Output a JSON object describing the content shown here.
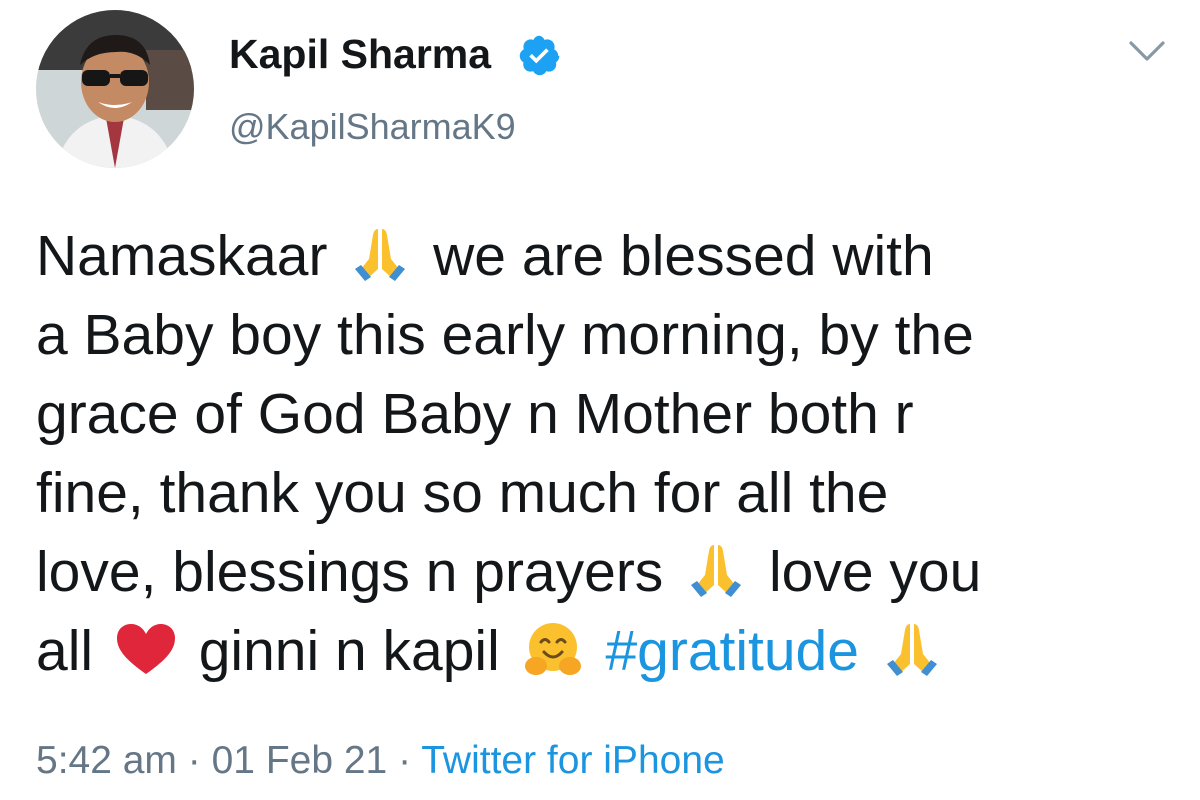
{
  "author": {
    "display_name": "Kapil Sharma",
    "handle": "@KapilSharmaK9",
    "verified": true,
    "avatar_icon": "profile-photo",
    "verified_icon": "verified-badge-icon"
  },
  "menu_icon": "chevron-down-icon",
  "tweet": {
    "lines": {
      "l1a": "Namaskaar",
      "l1b": "we are blessed with",
      "l2": "a Baby boy this early morning, by the",
      "l3": "grace of God Baby n Mother both r",
      "l4": "fine, thank you so much for all the",
      "l5a": "love, blessings n prayers",
      "l5b": "love you",
      "l6a": "all",
      "l6b": "ginni n kapil",
      "hashtag": "#gratitude"
    },
    "emojis": [
      "folded-hands-icon",
      "red-heart-icon",
      "hugging-face-icon"
    ]
  },
  "meta": {
    "time": "5:42 am",
    "separator": "·",
    "date": "01 Feb 21",
    "source": "Twitter for iPhone"
  },
  "colors": {
    "text": "#14171a",
    "secondary": "#657786",
    "link": "#1b95e0",
    "verified": "#1da1f2"
  }
}
